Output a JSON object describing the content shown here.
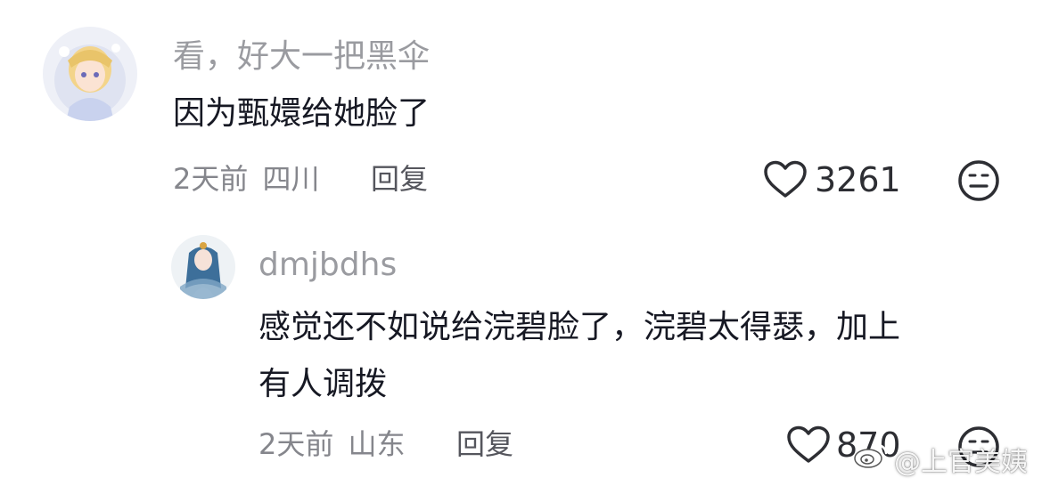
{
  "comments": [
    {
      "username": "看，好大一把黑伞",
      "text": "因为甄嬛给她脸了",
      "time": "2天前",
      "location": "四川",
      "reply_label": "回复",
      "likes": "3261"
    },
    {
      "username": "dmjbdhs",
      "text_line1": "感觉还不如说给浣碧脸了，浣碧太得瑟，加上",
      "text_line2": "有人调拨",
      "time": "2天前",
      "location": "山东",
      "reply_label": "回复",
      "likes": "870"
    }
  ],
  "watermark": "@上官美姨",
  "icons": {
    "like": "heart-outline-icon",
    "dislike": "neutral-face-icon",
    "watermark": "weibo-logo-icon"
  },
  "colors": {
    "text": "#161823",
    "username": "#9a9ba0",
    "meta": "#85868c",
    "icon": "#2d2e33"
  }
}
